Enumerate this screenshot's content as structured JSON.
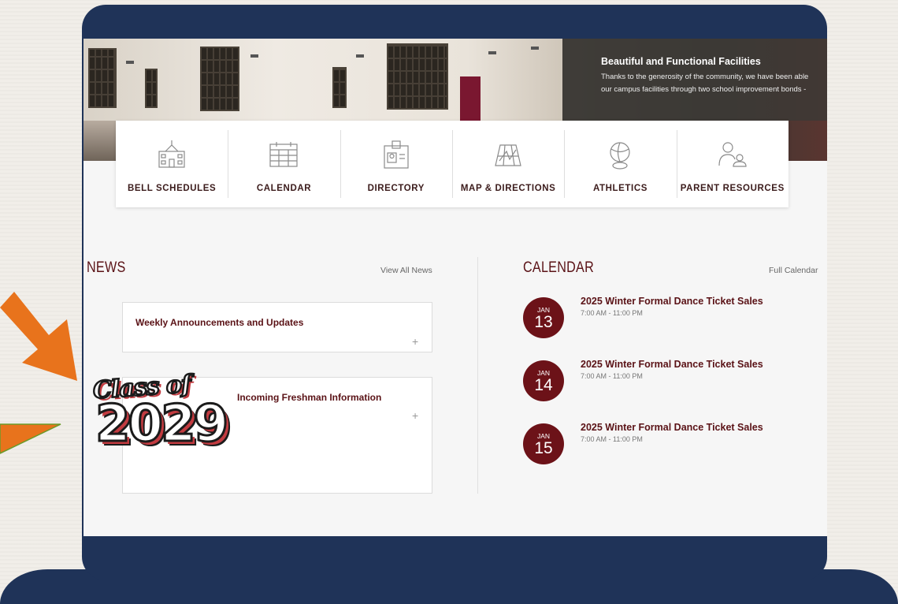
{
  "hero": {
    "title": "Beautiful and Functional Facilities",
    "text_line1": "Thanks to the generosity of the community, we have been able",
    "text_line2": "our campus facilities through two school improvement bonds -"
  },
  "quick_links": [
    {
      "label": "BELL SCHEDULES",
      "icon": "school-building-icon"
    },
    {
      "label": "CALENDAR",
      "icon": "calendar-grid-icon"
    },
    {
      "label": "DIRECTORY",
      "icon": "id-badge-icon"
    },
    {
      "label": "MAP & DIRECTIONS",
      "icon": "map-icon"
    },
    {
      "label": "ATHLETICS",
      "icon": "sports-balls-icon"
    },
    {
      "label": "PARENT RESOURCES",
      "icon": "parent-child-icon"
    }
  ],
  "news": {
    "title": "NEWS",
    "view_all": "View All News",
    "items": [
      {
        "title": "Weekly Announcements and Updates",
        "expand": "+"
      },
      {
        "title": "Incoming Freshman Information",
        "expand": "+"
      }
    ],
    "badge": {
      "script": "Class of",
      "year": "2029"
    }
  },
  "calendar": {
    "title": "CALENDAR",
    "full_link": "Full Calendar",
    "events": [
      {
        "month": "JAN",
        "day": "13",
        "title": "2025 Winter Formal Dance Ticket Sales",
        "time": "7:00 AM - 11:00 PM"
      },
      {
        "month": "JAN",
        "day": "14",
        "title": "2025 Winter Formal Dance Ticket Sales",
        "time": "7:00 AM - 11:00 PM"
      },
      {
        "month": "JAN",
        "day": "15",
        "title": "2025 Winter Formal Dance Ticket Sales",
        "time": "7:00 AM - 11:00 PM"
      }
    ]
  },
  "colors": {
    "frame": "#1f3358",
    "maroon": "#6c1218",
    "arrow_orange": "#e8731c"
  }
}
